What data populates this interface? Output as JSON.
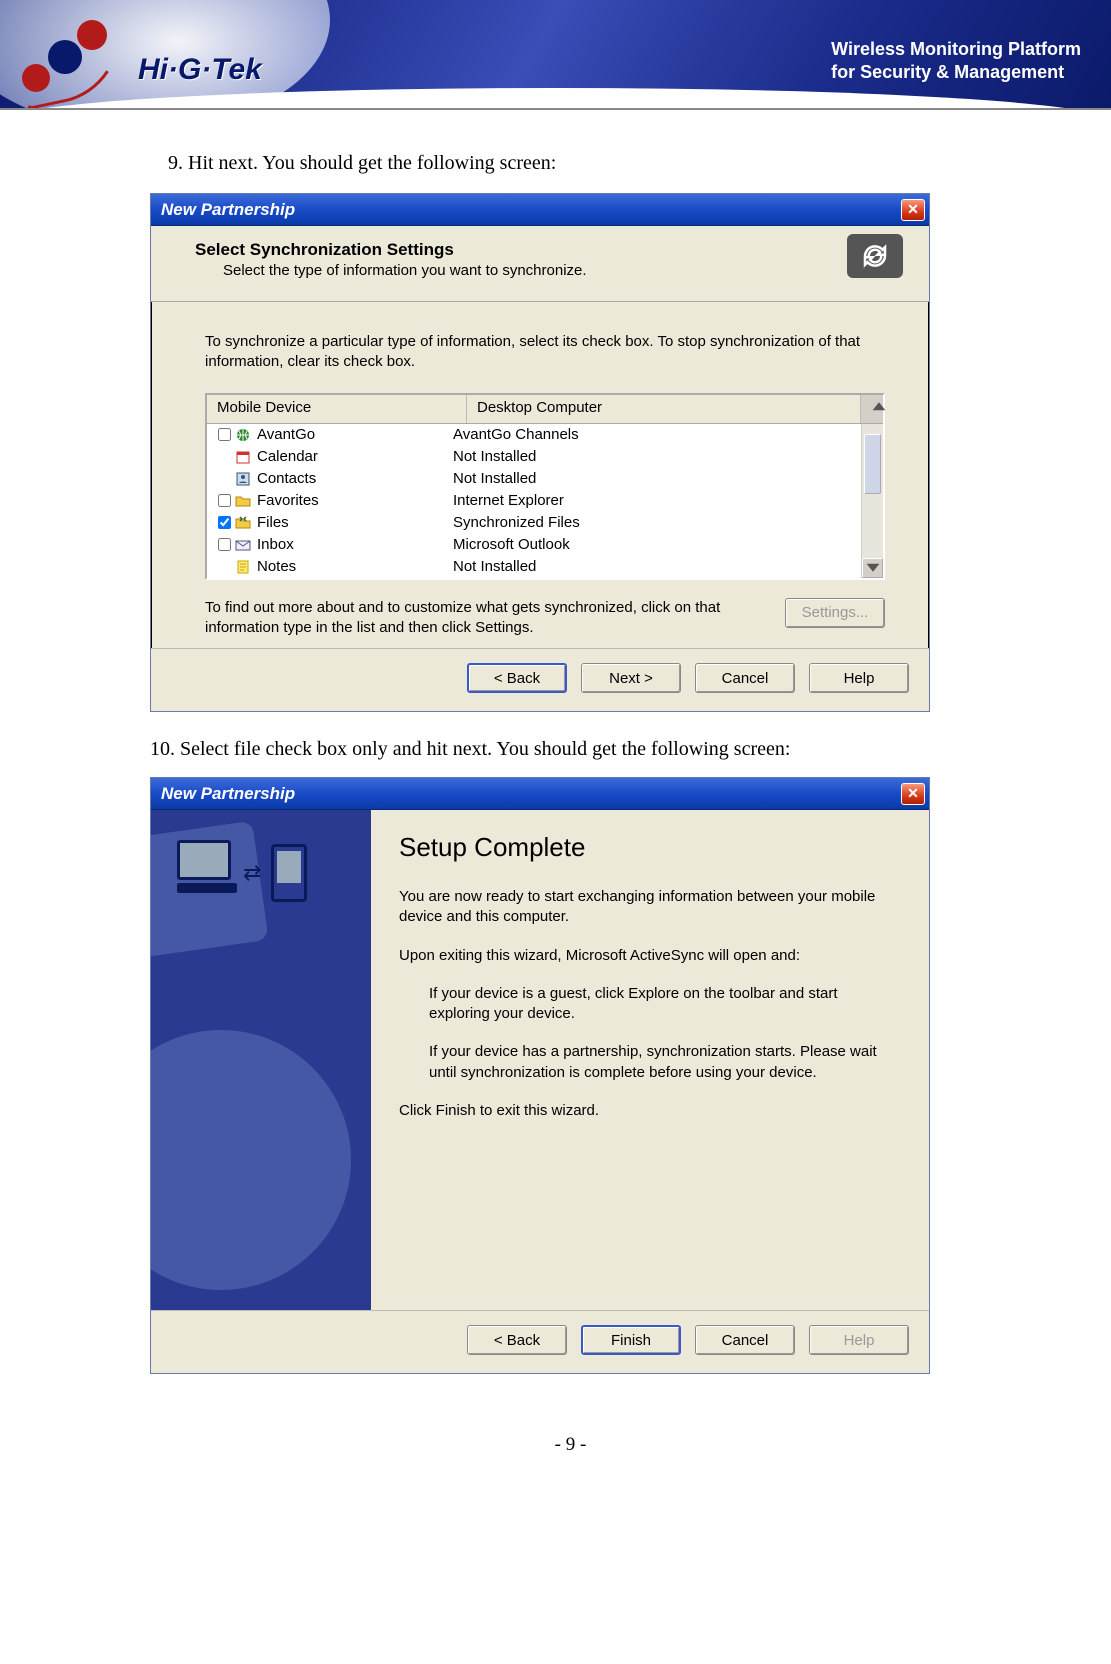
{
  "banner": {
    "logo_text": "Hi·G·Tek",
    "tagline_line1": "Wireless Monitoring Platform",
    "tagline_line2": "for Security & Management"
  },
  "step9": "9.   Hit next. You should get the following screen:",
  "step10": "10. Select file check box only and hit next. You should get the following screen:",
  "page_number": "- 9 -",
  "dlg1": {
    "title": "New Partnership",
    "heading": "Select Synchronization Settings",
    "subheading": "Select the type of information you want to synchronize.",
    "instruction": "To synchronize a particular type of information, select its check box. To stop synchronization of that information, clear its check box.",
    "col_mobile": "Mobile Device",
    "col_desktop": "Desktop Computer",
    "rows": [
      {
        "checked": false,
        "show_cb": true,
        "icon": "globe",
        "mobile": "AvantGo",
        "desktop": "AvantGo Channels"
      },
      {
        "checked": false,
        "show_cb": false,
        "icon": "calendar",
        "mobile": "Calendar",
        "desktop": "Not Installed"
      },
      {
        "checked": false,
        "show_cb": false,
        "icon": "contacts",
        "mobile": "Contacts",
        "desktop": "Not Installed"
      },
      {
        "checked": false,
        "show_cb": true,
        "icon": "folder",
        "mobile": "Favorites",
        "desktop": "Internet Explorer"
      },
      {
        "checked": true,
        "show_cb": true,
        "icon": "files",
        "mobile": "Files",
        "desktop": "Synchronized Files"
      },
      {
        "checked": false,
        "show_cb": true,
        "icon": "mail",
        "mobile": "Inbox",
        "desktop": "Microsoft Outlook"
      },
      {
        "checked": false,
        "show_cb": false,
        "icon": "notes",
        "mobile": "Notes",
        "desktop": "Not Installed"
      }
    ],
    "hint": "To find out more about and to customize what gets synchronized, click on that information type in the list and then click Settings.",
    "btn_settings": "Settings...",
    "btn_back": "< Back",
    "btn_next": "Next >",
    "btn_cancel": "Cancel",
    "btn_help": "Help"
  },
  "dlg2": {
    "title": "New Partnership",
    "heading": "Setup Complete",
    "p1": "You are now ready to start exchanging information between your mobile device and this computer.",
    "p2": "Upon exiting this wizard, Microsoft ActiveSync will open and:",
    "li1": "If your device is a guest, click Explore on the toolbar and start exploring your device.",
    "li2": "If your device has a partnership, synchronization starts. Please wait until synchronization is complete before using your device.",
    "p3": "Click Finish to exit this wizard.",
    "btn_back": "< Back",
    "btn_finish": "Finish",
    "btn_cancel": "Cancel",
    "btn_help": "Help"
  }
}
